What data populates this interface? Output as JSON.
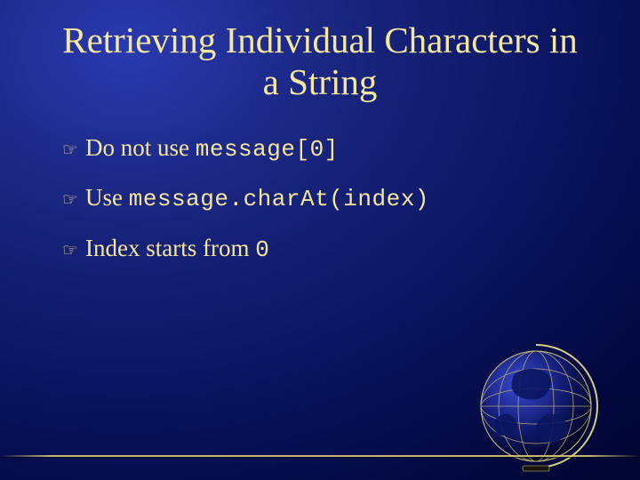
{
  "slide": {
    "title": "Retrieving Individual Characters in a String",
    "bullets": [
      {
        "pre": "Do not use ",
        "code": "message[0]",
        "post": ""
      },
      {
        "pre": "Use ",
        "code": "message.charAt(index)",
        "post": ""
      },
      {
        "pre": "Index starts from ",
        "code": "0",
        "post": ""
      }
    ],
    "bullet_glyph": "☞"
  }
}
